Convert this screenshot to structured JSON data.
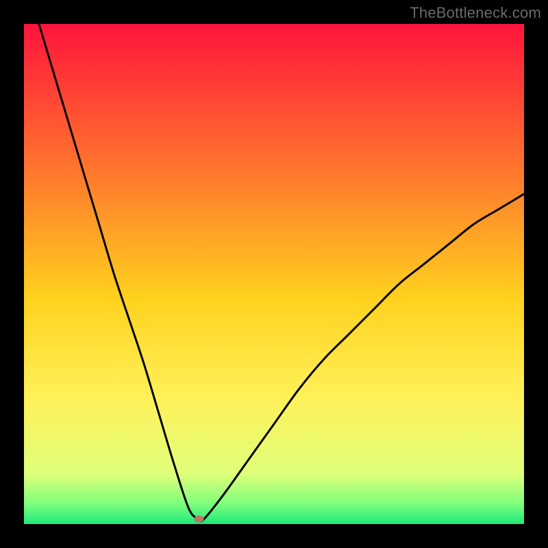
{
  "attribution": "TheBottleneck.com",
  "chart_data": {
    "type": "line",
    "title": "",
    "xlabel": "",
    "ylabel": "",
    "xlim": [
      0,
      100
    ],
    "ylim": [
      0,
      100
    ],
    "grid": false,
    "background": "gradient-red-to-green-vertical",
    "series": [
      {
        "name": "bottleneck-curve",
        "x": [
          3,
          6,
          9,
          12,
          15,
          18,
          21,
          24,
          27,
          30,
          33,
          35,
          36,
          40,
          45,
          50,
          55,
          60,
          65,
          70,
          75,
          80,
          85,
          90,
          95,
          100
        ],
        "y": [
          100,
          90,
          80,
          70,
          60,
          50,
          41,
          32,
          22,
          12,
          3,
          1,
          1,
          6,
          13,
          20,
          27,
          33,
          38,
          43,
          48,
          52,
          56,
          60,
          63,
          66
        ]
      }
    ],
    "marker": {
      "x": 35,
      "y": 1,
      "color": "#bb7766"
    },
    "gradient_stops": [
      {
        "pos": 0,
        "color": "#ff143c"
      },
      {
        "pos": 35,
        "color": "#ff8a2a"
      },
      {
        "pos": 55,
        "color": "#ffd21e"
      },
      {
        "pos": 75,
        "color": "#fff15a"
      },
      {
        "pos": 90,
        "color": "#dfff7a"
      },
      {
        "pos": 96,
        "color": "#7dff7d"
      },
      {
        "pos": 100,
        "color": "#1de87a"
      }
    ]
  }
}
